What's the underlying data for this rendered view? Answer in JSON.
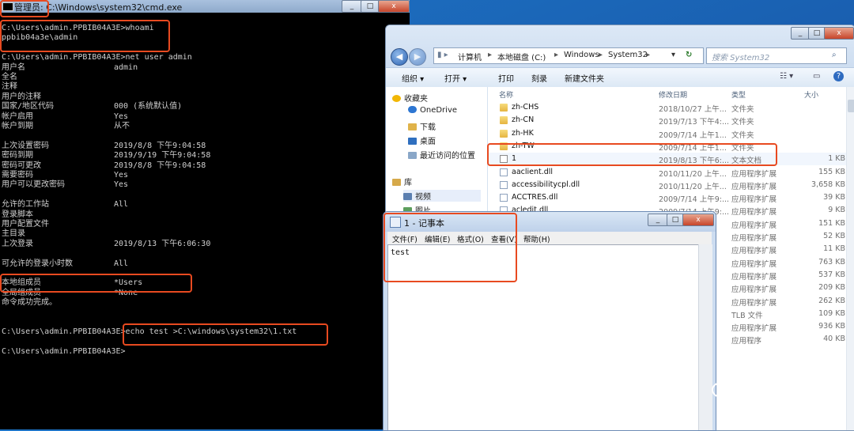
{
  "cmd": {
    "title": "管理员: C:\\Windows\\system32\\cmd.exe",
    "controls": [
      "_",
      "□",
      "x"
    ],
    "lines": [
      {
        "k": "C:\\Users\\admin.PPBIB04A3E>whoami",
        "v": ""
      },
      {
        "k": "ppbib04a3e\\admin",
        "v": ""
      },
      {
        "k": "",
        "v": ""
      },
      {
        "k": "C:\\Users\\admin.PPBIB04A3E>net user admin",
        "v": ""
      },
      {
        "k": "用户名",
        "v": "admin"
      },
      {
        "k": "全名",
        "v": ""
      },
      {
        "k": "注释",
        "v": ""
      },
      {
        "k": "用户的注释",
        "v": ""
      },
      {
        "k": "国家/地区代码",
        "v": "000 (系统默认值)"
      },
      {
        "k": "帐户启用",
        "v": "Yes"
      },
      {
        "k": "帐户到期",
        "v": "从不"
      },
      {
        "k": "",
        "v": ""
      },
      {
        "k": "上次设置密码",
        "v": "2019/8/8 下午9:04:58"
      },
      {
        "k": "密码到期",
        "v": "2019/9/19 下午9:04:58"
      },
      {
        "k": "密码可更改",
        "v": "2019/8/8 下午9:04:58"
      },
      {
        "k": "需要密码",
        "v": "Yes"
      },
      {
        "k": "用户可以更改密码",
        "v": "Yes"
      },
      {
        "k": "",
        "v": ""
      },
      {
        "k": "允许的工作站",
        "v": "All"
      },
      {
        "k": "登录脚本",
        "v": ""
      },
      {
        "k": "用户配置文件",
        "v": ""
      },
      {
        "k": "主目录",
        "v": ""
      },
      {
        "k": "上次登录",
        "v": "2019/8/13 下午6:06:30"
      },
      {
        "k": "",
        "v": ""
      },
      {
        "k": "可允许的登录小时数",
        "v": "All"
      },
      {
        "k": "",
        "v": ""
      },
      {
        "k": "本地组成员",
        "v": "*Users"
      },
      {
        "k": "全局组成员",
        "v": "*None"
      },
      {
        "k": "命令成功完成。",
        "v": ""
      },
      {
        "k": "",
        "v": ""
      },
      {
        "k": "",
        "v": ""
      },
      {
        "k": "C:\\Users\\admin.PPBIB04A3E>echo test >C:\\windows\\system32\\1.txt",
        "v": ""
      },
      {
        "k": "",
        "v": ""
      },
      {
        "k": "C:\\Users\\admin.PPBIB04A3E>",
        "v": ""
      }
    ]
  },
  "explorer": {
    "controls": [
      "_",
      "□",
      "x"
    ],
    "breadcrumb": [
      "计算机",
      "本地磁盘 (C:)",
      "Windows",
      "System32"
    ],
    "search_placeholder": "搜索 System32",
    "toolbar": [
      "组织 ▾",
      "打开 ▾",
      "打印",
      "刻录",
      "新建文件夹"
    ],
    "nav": {
      "favorites": "收藏夹",
      "items": [
        "OneDrive",
        "下载",
        "桌面",
        "最近访问的位置"
      ],
      "library": "库",
      "library_items": [
        "视频",
        "图片"
      ]
    },
    "columns": [
      "名称",
      "修改日期",
      "类型",
      "大小"
    ],
    "files": [
      {
        "name": "zh-CHS",
        "date": "2018/10/27 上午...",
        "type": "文件夹",
        "size": "",
        "kind": "folder"
      },
      {
        "name": "zh-CN",
        "date": "2019/7/13 下午4:...",
        "type": "文件夹",
        "size": "",
        "kind": "folder"
      },
      {
        "name": "zh-HK",
        "date": "2009/7/14 上午1...",
        "type": "文件夹",
        "size": "",
        "kind": "folder"
      },
      {
        "name": "zh-TW",
        "date": "2009/7/14 上午1...",
        "type": "文件夹",
        "size": "",
        "kind": "folder"
      },
      {
        "name": "1",
        "date": "2019/8/13 下午6:...",
        "type": "文本文档",
        "size": "1 KB",
        "kind": "txt"
      },
      {
        "name": "aaclient.dll",
        "date": "2010/11/20 上午...",
        "type": "应用程序扩展",
        "size": "155 KB",
        "kind": "dll"
      },
      {
        "name": "accessibilitycpl.dll",
        "date": "2010/11/20 上午...",
        "type": "应用程序扩展",
        "size": "3,658 KB",
        "kind": "dll"
      },
      {
        "name": "ACCTRES.dll",
        "date": "2009/7/14 上午9:...",
        "type": "应用程序扩展",
        "size": "39 KB",
        "kind": "dll"
      },
      {
        "name": "acledit.dll",
        "date": "2009/7/14 上午9:...",
        "type": "应用程序扩展",
        "size": "9 KB",
        "kind": "dll"
      },
      {
        "name": "",
        "date": "",
        "type": "应用程序扩展",
        "size": "151 KB",
        "kind": "dll"
      },
      {
        "name": "",
        "date": "",
        "type": "应用程序扩展",
        "size": "52 KB",
        "kind": "dll"
      },
      {
        "name": "",
        "date": "",
        "type": "应用程序扩展",
        "size": "11 KB",
        "kind": "dll"
      },
      {
        "name": "",
        "date": "",
        "type": "应用程序扩展",
        "size": "763 KB",
        "kind": "dll"
      },
      {
        "name": "",
        "date": "",
        "type": "应用程序扩展",
        "size": "537 KB",
        "kind": "dll"
      },
      {
        "name": "",
        "date": "",
        "type": "应用程序扩展",
        "size": "209 KB",
        "kind": "dll"
      },
      {
        "name": "",
        "date": "",
        "type": "应用程序扩展",
        "size": "262 KB",
        "kind": "dll"
      },
      {
        "name": "",
        "date": "",
        "type": "TLB 文件",
        "size": "109 KB",
        "kind": "dll"
      },
      {
        "name": "",
        "date": "",
        "type": "应用程序扩展",
        "size": "936 KB",
        "kind": "dll"
      },
      {
        "name": "",
        "date": "",
        "type": "应用程序",
        "size": "40 KB",
        "kind": "dll"
      }
    ]
  },
  "notepad": {
    "title": "1 - 记事本",
    "controls": [
      "_",
      "□",
      "x"
    ],
    "menu": [
      "文件(F)",
      "编辑(E)",
      "格式(O)",
      "查看(V)",
      "帮助(H)"
    ],
    "content": "test"
  },
  "watermark": "乌云安全",
  "colors": {
    "highlight": "#e84a20",
    "console_bg": "#000000",
    "desktop": "#1a5fb0"
  }
}
